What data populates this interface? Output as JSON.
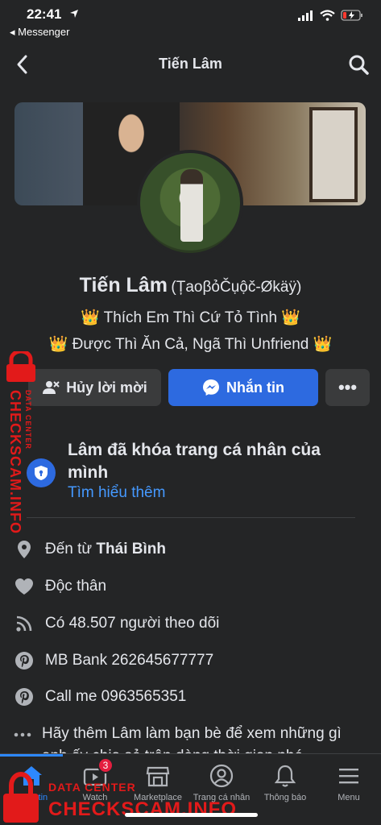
{
  "status": {
    "time": "22:41",
    "back_app": "◂ Messenger"
  },
  "nav": {
    "title": "Tiến Lâm"
  },
  "profile": {
    "name": "Tiến Lâm",
    "alt_name": "(ȚaoβỏČụộč-Økäÿ)",
    "bio_1": "👑 Thích Em Thì Cứ Tỏ Tình 👑",
    "bio_2": "👑 Được Thì Ăn Cả, Ngã Thì Unfriend 👑"
  },
  "actions": {
    "cancel": "Hủy lời mời",
    "message": "Nhắn tin",
    "more": "•••"
  },
  "locked": {
    "text": "Lâm đã khóa trang cá nhân của mình",
    "link": "Tìm hiểu thêm"
  },
  "info": [
    {
      "icon": "location-pin-icon",
      "prefix": "Đến từ ",
      "value": "Thái Bình"
    },
    {
      "icon": "heart-icon",
      "text": "Độc thân"
    },
    {
      "icon": "rss-icon",
      "text": "Có 48.507 người theo dõi"
    },
    {
      "icon": "pinterest-icon",
      "text": "MB Bank 262645677777"
    },
    {
      "icon": "pinterest-icon",
      "text": "Call me 0963565351"
    },
    {
      "icon": "more-dots-icon",
      "text": "Hãy thêm Lâm làm bạn bè để xem những gì anh ấy chia sẻ trên dòng thời gian nhé."
    }
  ],
  "tabs": [
    {
      "label": "Bảng tin",
      "icon": "home-icon"
    },
    {
      "label": "Watch",
      "icon": "watch-icon",
      "badge": "3"
    },
    {
      "label": "Marketplace",
      "icon": "marketplace-icon"
    },
    {
      "label": "Trang cá nhân",
      "icon": "profile-icon"
    },
    {
      "label": "Thông báo",
      "icon": "bell-icon"
    },
    {
      "label": "Menu",
      "icon": "menu-icon"
    }
  ],
  "watermark": {
    "side_big": "CHECKSCAM.INFO",
    "side_small": "DATA CENTER",
    "bottom_small": "DATA CENTER",
    "bottom_big": "CHECKSCAM.INFO"
  },
  "colors": {
    "background": "#242526",
    "accent": "#2d6ae0",
    "link": "#4599ff",
    "watermark": "#e21a1a",
    "badge": "#e41e3f"
  }
}
